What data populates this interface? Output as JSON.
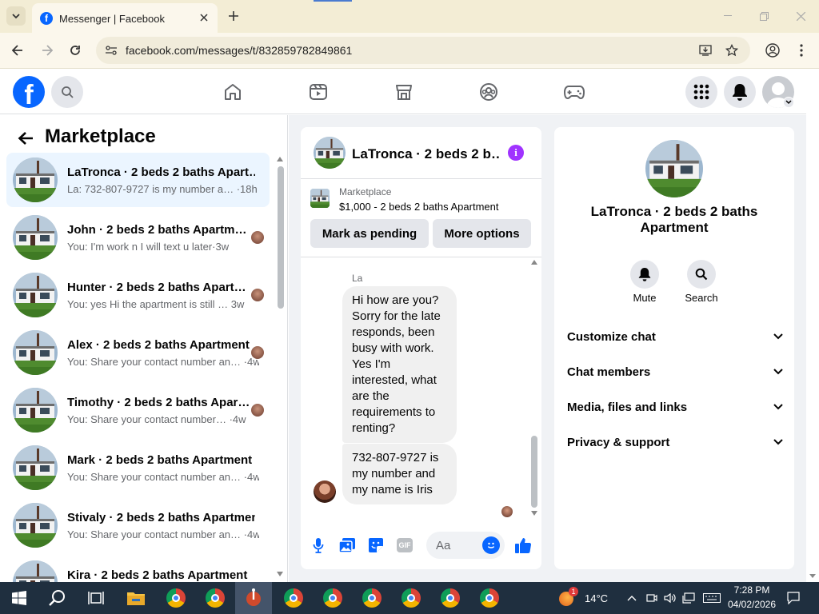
{
  "browser": {
    "tab_title": "Messenger | Facebook",
    "url": "facebook.com/messages/t/832859782849861"
  },
  "left": {
    "title": "Marketplace",
    "conversations": [
      {
        "name": "LaTronca · 2 beds 2 baths Apart…",
        "sub": "La: 732-807-9727 is my number a… ·18h"
      },
      {
        "name": "John · 2 beds 2 baths Apartm…",
        "sub": "You: I'm work n I will text u later·3w"
      },
      {
        "name": "Hunter · 2 beds 2 baths Apart…",
        "sub": "You: yes Hi the apartment is still … 3w"
      },
      {
        "name": "Alex · 2 beds 2 baths Apartment",
        "sub": "You: Share your contact number an… ·4w"
      },
      {
        "name": "Timothy · 2 beds 2 baths Apar…",
        "sub": "You: Share your contact number… ·4w"
      },
      {
        "name": "Mark · 2 beds 2 baths Apartment",
        "sub": "You: Share your contact number an… ·4w"
      },
      {
        "name": "Stivaly · 2 beds 2 baths Apartment",
        "sub": "You: Share your contact number an… ·4w"
      },
      {
        "name": "Kira · 2 beds 2 baths Apartment",
        "sub": ""
      }
    ]
  },
  "chat": {
    "title": "LaTronca · 2 beds 2 b…",
    "listing_label": "Marketplace",
    "listing_price": "$1,000 - 2 beds 2 baths Apartment",
    "btn_pending": "Mark as pending",
    "btn_more": "More options",
    "sender": "La",
    "msg1": "Hi how are you? Sorry for the late responds, been busy with work. Yes I'm interested, what are the requirements to renting?",
    "msg2": "732-807-9727 is my number and my name is Iris",
    "input_placeholder": "Aa"
  },
  "info": {
    "name": "LaTronca · 2 beds 2 baths Apartment",
    "mute": "Mute",
    "search": "Search",
    "rows": [
      "Customize chat",
      "Chat members",
      "Media, files and links",
      "Privacy & support"
    ]
  },
  "taskbar": {
    "temp": "14°C",
    "time": "7:28 PM",
    "date": "04/02/2026",
    "weather_badge": "1"
  },
  "colors": {
    "fb_blue": "#0866ff",
    "purple": "#a033ff",
    "taskbar": "#1f2f3f"
  }
}
